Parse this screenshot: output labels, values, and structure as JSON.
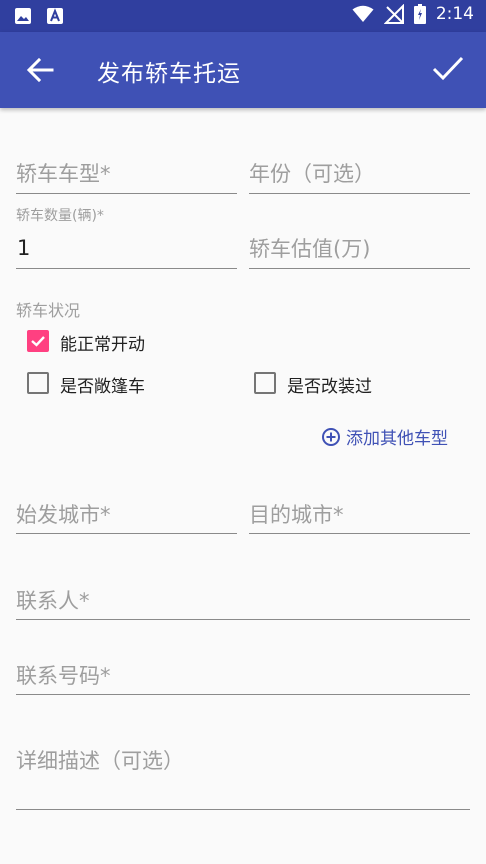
{
  "status_bar": {
    "time": "2:14"
  },
  "app_bar": {
    "title": "发布轿车托运"
  },
  "form": {
    "car_model": "轿车车型*",
    "year": "年份（可选）",
    "quantity_label": "轿车数量(辆)*",
    "quantity_value": "1",
    "estimate": "轿车估值(万)",
    "condition_label": "轿车状况",
    "options": {
      "can_drive": "能正常开动",
      "convertible": "是否敞篷车",
      "modified": "是否改装过"
    },
    "add_other": "添加其他车型",
    "origin_city": "始发城市*",
    "dest_city": "目的城市*",
    "contact": "联系人*",
    "phone": "联系号码*",
    "description": "详细描述（可选）"
  },
  "colors": {
    "primary": "#3f51b5",
    "primary_dark": "#303f9f",
    "accent": "#ff4081"
  }
}
